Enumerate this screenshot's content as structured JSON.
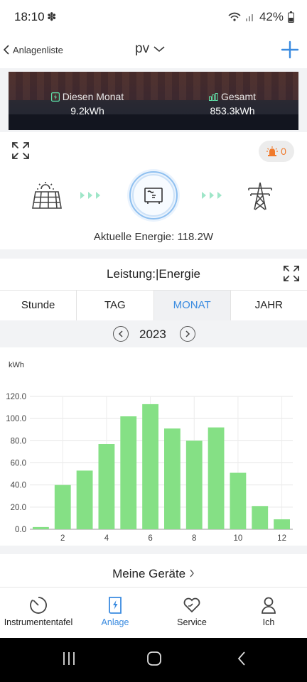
{
  "status": {
    "time": "18:10",
    "battery": "42%"
  },
  "header": {
    "back_label": "Anlagenliste",
    "title": "pv"
  },
  "banner": {
    "month_label": "Diesen Monat",
    "month_value": "9.2kWh",
    "total_label": "Gesamt",
    "total_value": "853.3kWh"
  },
  "alarm_count": "0",
  "current_energy": {
    "label": "Aktuelle Energie:",
    "value": "118.2W"
  },
  "chart_section": {
    "title": "Leistung:|Energie",
    "tabs": [
      "Stunde",
      "TAG",
      "MONAT",
      "JAHR"
    ],
    "active_tab": "MONAT",
    "year": "2023",
    "unit": "kWh"
  },
  "chart_data": {
    "type": "bar",
    "categories": [
      "1",
      "2",
      "3",
      "4",
      "5",
      "6",
      "7",
      "8",
      "9",
      "10",
      "11",
      "12"
    ],
    "values": [
      2,
      40,
      53,
      77,
      102,
      113,
      91,
      80,
      92,
      51,
      21,
      9
    ],
    "x_tick_labels": [
      "2",
      "4",
      "6",
      "8",
      "10",
      "12"
    ],
    "ylabel": "kWh",
    "y_ticks": [
      "0.0",
      "20.0",
      "40.0",
      "60.0",
      "80.0",
      "100.0",
      "120.0"
    ],
    "ylim": [
      0,
      120
    ],
    "grid": true,
    "color": "#85e085"
  },
  "devices": {
    "label": "Meine Geräte"
  },
  "bottom_nav": [
    {
      "label": "Instrumententafel"
    },
    {
      "label": "Anlage"
    },
    {
      "label": "Service"
    },
    {
      "label": "Ich"
    }
  ],
  "colors": {
    "accent": "#3a8be0",
    "flow": "#9fe6c8",
    "alarm": "#f07a2c",
    "bar": "#85e085"
  }
}
